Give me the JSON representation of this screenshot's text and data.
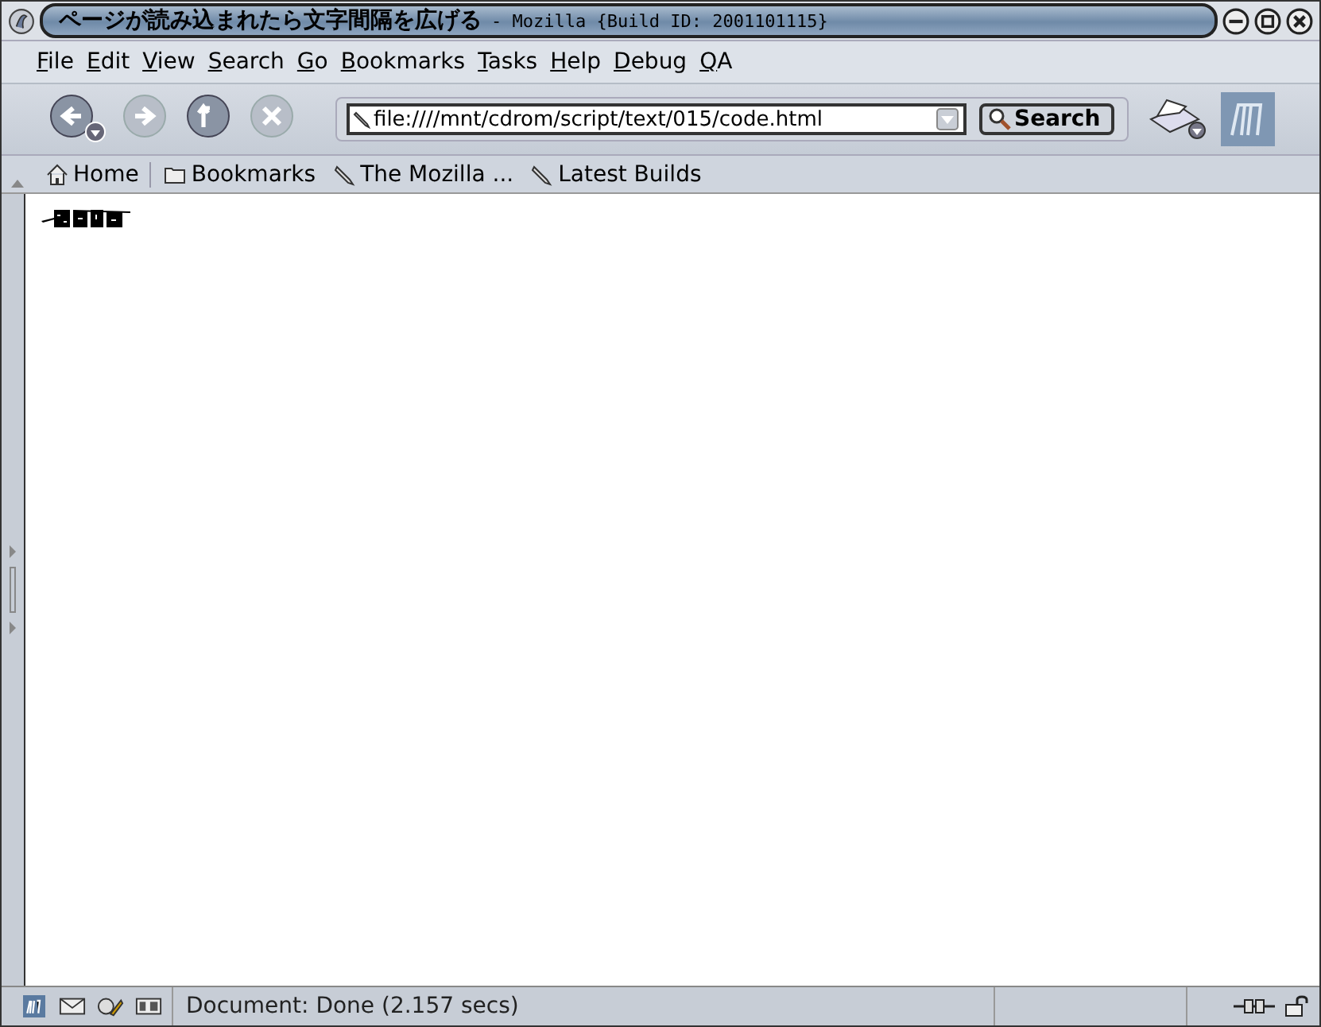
{
  "window": {
    "title": "ページが読み込まれたら文字間隔を広げる",
    "subtitle": "- Mozilla {Build ID: 2001101115}"
  },
  "menu": [
    "File",
    "Edit",
    "View",
    "Search",
    "Go",
    "Bookmarks",
    "Tasks",
    "Help",
    "Debug",
    "QA"
  ],
  "navigation": {
    "back": {
      "disabled": false
    },
    "forward": {
      "disabled": true
    },
    "reload": {
      "disabled": false
    },
    "stop": {
      "disabled": true
    }
  },
  "url_bar": {
    "value": "file:////mnt/cdrom/script/text/015/code.html"
  },
  "search_button": "Search",
  "personal_toolbar": [
    {
      "kind": "home",
      "label": "Home"
    },
    {
      "kind": "folder",
      "label": "Bookmarks"
    },
    {
      "kind": "link",
      "label": "The Mozilla ..."
    },
    {
      "kind": "link",
      "label": "Latest Builds"
    }
  ],
  "status_bar": {
    "text": "Document: Done (2.157 secs)"
  }
}
